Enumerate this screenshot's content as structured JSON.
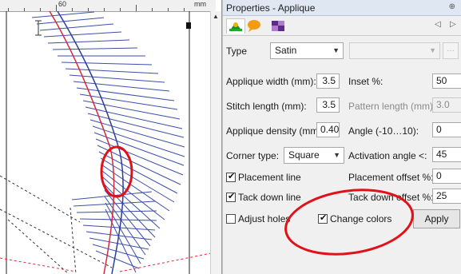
{
  "canvas": {
    "ruler_label": "60",
    "ruler_unit": "mm",
    "annotation_color": "#e01218"
  },
  "panel": {
    "title": "Properties - Applique",
    "pin_icon": "pin-icon",
    "tabs": [
      {
        "name": "applique-tab",
        "icon": "applique-icon",
        "color": "#1e8f1e"
      },
      {
        "name": "speech-tab",
        "icon": "speech-bubble-icon",
        "color": "#f39c12"
      },
      {
        "name": "fill-tab",
        "icon": "pattern-fill-icon",
        "color": "#8e44ad"
      }
    ],
    "type": {
      "label": "Type",
      "value": "Satin"
    },
    "applique_width": {
      "label": "Applique width (mm):",
      "value": "3.5"
    },
    "inset": {
      "label": "Inset %:",
      "value": "50"
    },
    "stitch_length": {
      "label": "Stitch length (mm):",
      "value": "3.5"
    },
    "pattern_length": {
      "label": "Pattern length (mm):",
      "value": "3.0"
    },
    "applique_density": {
      "label": "Applique density (mm):",
      "value": "0.40"
    },
    "angle": {
      "label": "Angle (-10…10):",
      "value": "0"
    },
    "corner_type": {
      "label": "Corner type:",
      "value": "Square"
    },
    "activation_angle": {
      "label": "Activation angle <:",
      "value": "45"
    },
    "placement_line": {
      "label": "Placement line",
      "checked": true
    },
    "placement_offset": {
      "label": "Placement offset %:",
      "value": "0"
    },
    "tack_down_line": {
      "label": "Tack down line",
      "checked": true
    },
    "tack_down_offset": {
      "label": "Tack down offset %:",
      "value": "25"
    },
    "adjust_holes": {
      "label": "Adjust holes",
      "checked": false
    },
    "change_colors": {
      "label": "Change colors",
      "checked": true
    },
    "apply_label": "Apply"
  }
}
